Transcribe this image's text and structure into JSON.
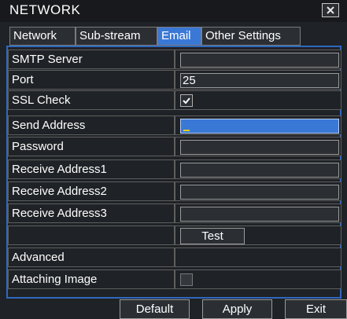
{
  "window": {
    "title": "NETWORK",
    "close_icon": "close-icon"
  },
  "tabs": [
    {
      "label": "Network",
      "active": false
    },
    {
      "label": "Sub-stream",
      "active": false
    },
    {
      "label": "Email",
      "active": true
    },
    {
      "label": "Other Settings",
      "active": false
    }
  ],
  "form": {
    "smtp_server": {
      "label": "SMTP Server",
      "value": ""
    },
    "port": {
      "label": "Port",
      "value": "25"
    },
    "ssl_check": {
      "label": "SSL Check",
      "checked": true
    },
    "send_address": {
      "label": "Send Address",
      "value": ""
    },
    "password": {
      "label": "Password",
      "value": ""
    },
    "receive_address1": {
      "label": "Receive Address1",
      "value": ""
    },
    "receive_address2": {
      "label": "Receive Address2",
      "value": ""
    },
    "receive_address3": {
      "label": "Receive Address3",
      "value": ""
    },
    "test_button": "Test",
    "advanced": {
      "label": "Advanced"
    },
    "attaching_image": {
      "label": "Attaching Image",
      "checked": false
    }
  },
  "footer": {
    "default_label": "Default",
    "apply_label": "Apply",
    "exit_label": "Exit"
  },
  "colors": {
    "accent": "#3a78d6",
    "frame": "#2f68c0",
    "background": "#1f2226"
  }
}
